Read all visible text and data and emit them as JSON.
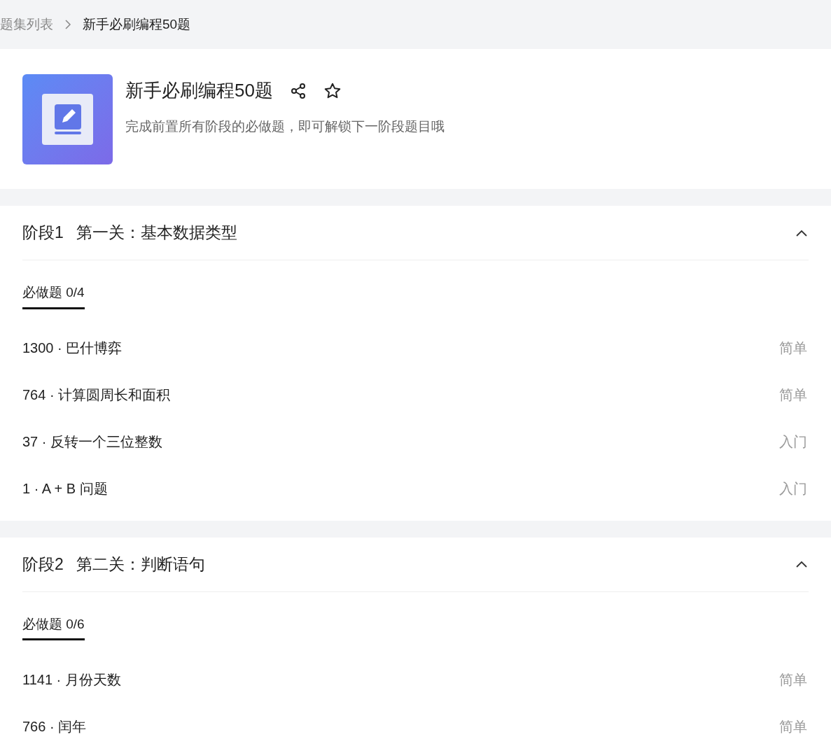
{
  "breadcrumb": [
    {
      "label": "题集列表",
      "current": false
    },
    {
      "label": "新手必刷编程50题",
      "current": true
    }
  ],
  "header": {
    "title": "新手必刷编程50题",
    "description": "完成前置所有阶段的必做题，即可解锁下一阶段题目哦"
  },
  "stages": [
    {
      "stage": "阶段1",
      "title": "第一关：基本数据类型",
      "expanded": true,
      "tabs": [
        {
          "label": "必做题 0/4",
          "selected": true
        }
      ],
      "problems": [
        {
          "name": "1300 · 巴什博弈",
          "difficulty": "简单"
        },
        {
          "name": "764 · 计算圆周长和面积",
          "difficulty": "简单"
        },
        {
          "name": "37 · 反转一个三位整数",
          "difficulty": "入门"
        },
        {
          "name": "1 · A + B 问题",
          "difficulty": "入门"
        }
      ]
    },
    {
      "stage": "阶段2",
      "title": "第二关：判断语句",
      "expanded": true,
      "tabs": [
        {
          "label": "必做题 0/6",
          "selected": true
        }
      ],
      "problems": [
        {
          "name": "1141 · 月份天数",
          "difficulty": "简单"
        },
        {
          "name": "766 · 闰年",
          "difficulty": "简单"
        }
      ]
    }
  ]
}
